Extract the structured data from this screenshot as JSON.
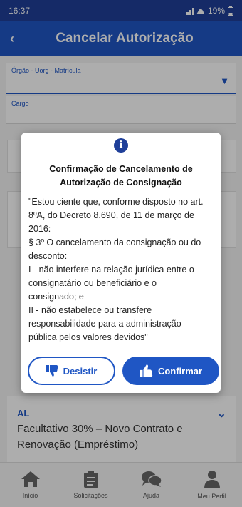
{
  "status_bar": {
    "time": "16:37",
    "battery": "19%"
  },
  "header": {
    "title": "Cancelar Autorização"
  },
  "form": {
    "field1_label": "Órgão - Uorg - Matrícula",
    "field2_label": "Cargo"
  },
  "card": {
    "code": "AL",
    "description": "Facultativo 30% – Novo Contrato e Renovação (Empréstimo)"
  },
  "dialog": {
    "title_line1": "Confirmação de Cancelamento de",
    "title_line2": "Autorização de Consignação",
    "body_lines": [
      "\"Estou ciente que, conforme disposto no art.",
      "8ºA, do Decreto 8.690, de 11 de março de",
      "2016:",
      "§ 3º O cancelamento da consignação ou do",
      "desconto:",
      "I - não interfere na relação jurídica entre o",
      "consignatário ou beneficiário e o",
      "consignado; e",
      "II - não estabelece ou transfere",
      "responsabilidade para a administração",
      "pública pelos valores devidos\""
    ],
    "cancel_label": "Desistir",
    "confirm_label": "Confirmar"
  },
  "nav": {
    "items": [
      {
        "label": "Início",
        "icon": "home-icon"
      },
      {
        "label": "Solicitações",
        "icon": "clipboard-icon"
      },
      {
        "label": "Ajuda",
        "icon": "chat-icon"
      },
      {
        "label": "Meu Perfil",
        "icon": "user-icon"
      }
    ]
  },
  "colors": {
    "primary": "#1f56c4",
    "status_bar": "#1f3f99",
    "overlay": "rgba(0,0,0,0.32)"
  }
}
